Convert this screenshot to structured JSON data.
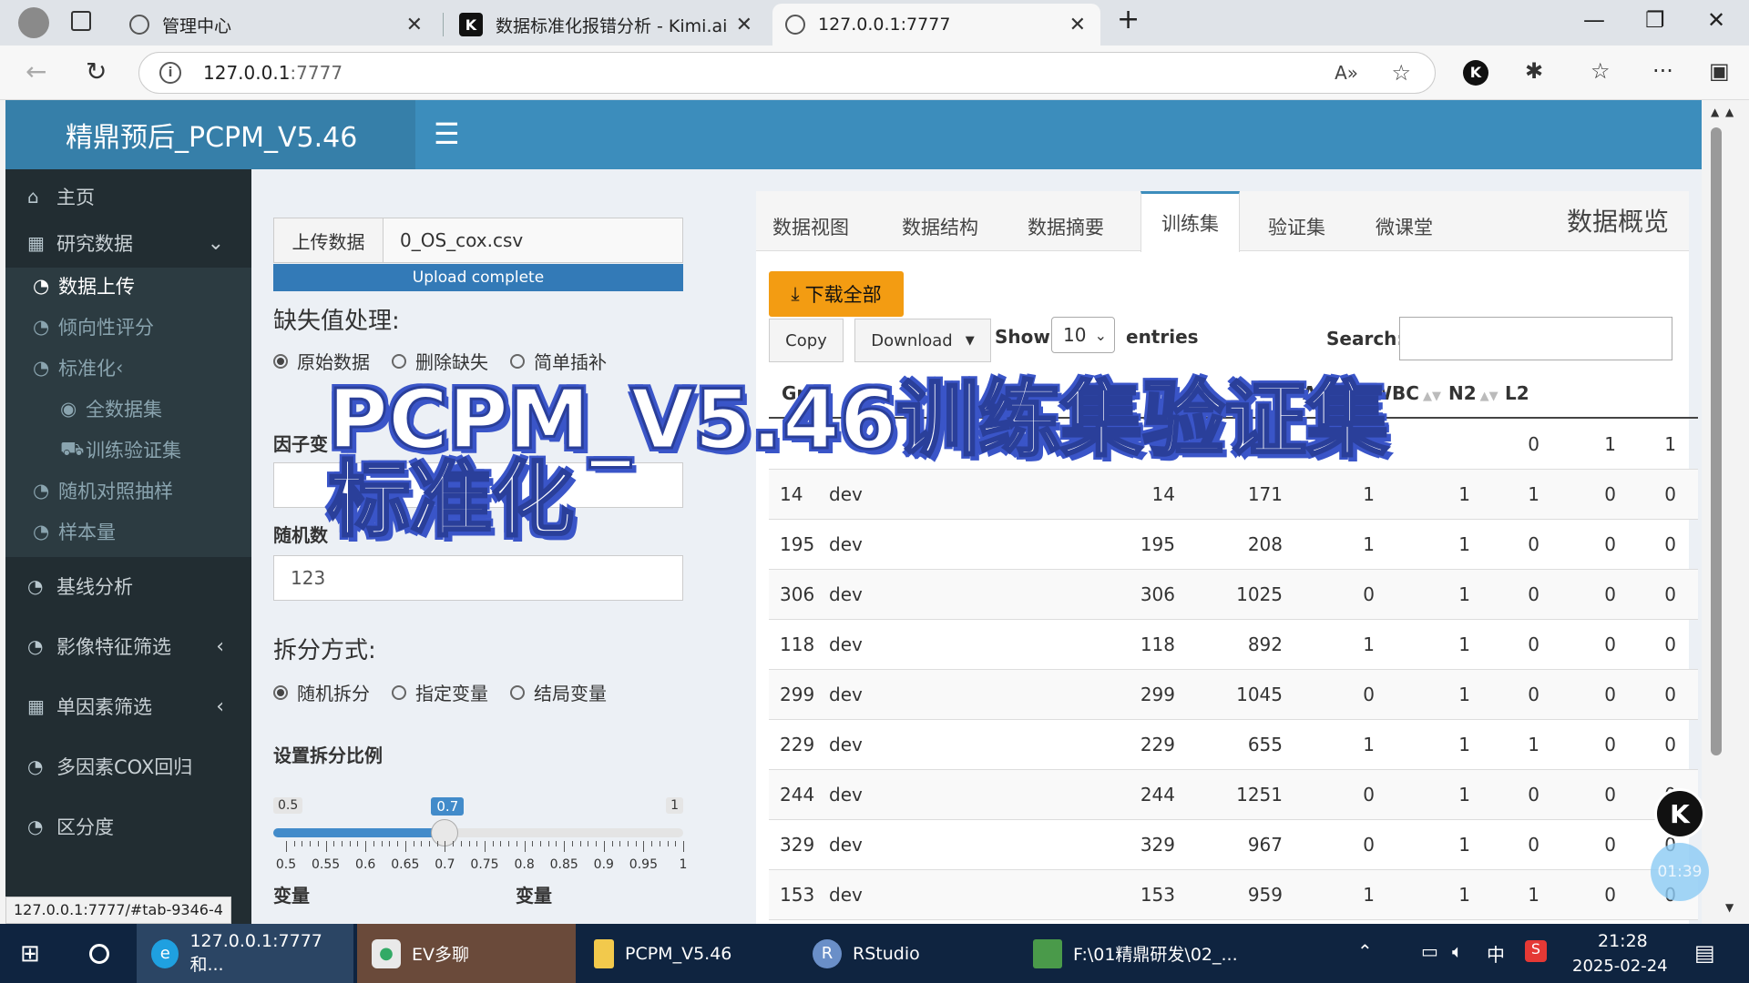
{
  "browser": {
    "tabs": [
      {
        "label": "管理中心",
        "icon": "globe-icon"
      },
      {
        "label": "数据标准化报错分析 - Kimi.ai",
        "icon": "kimi-icon"
      },
      {
        "label": "127.0.0.1:7777",
        "icon": "globe-icon"
      }
    ],
    "url_host": "127.0.0.1",
    "url_port": ":7777",
    "status_url": "127.0.0.1:7777/#tab-9346-4"
  },
  "app": {
    "title": "精鼎预后_PCPM_V5.46",
    "sidebar": [
      {
        "label": "主页"
      },
      {
        "label": "研究数据"
      },
      {
        "label": "数据上传"
      },
      {
        "label": "倾向性评分"
      },
      {
        "label": "标准化"
      },
      {
        "label": "全数据集"
      },
      {
        "label": "训练验证集"
      },
      {
        "label": "随机对照抽样"
      },
      {
        "label": "样本量"
      },
      {
        "label": "基线分析"
      },
      {
        "label": "影像特征筛选"
      },
      {
        "label": "单因素筛选"
      },
      {
        "label": "多因素COX回归"
      },
      {
        "label": "区分度"
      }
    ]
  },
  "form": {
    "upload_button": "上传数据",
    "file_name": "0_OS_cox.csv",
    "upload_status": "Upload complete",
    "missing_label": "缺失值处理:",
    "missing_options": [
      "原始数据",
      "删除缺失",
      "简单插补"
    ],
    "factor_label": "因子变",
    "seed_label": "随机数",
    "seed_value": "123",
    "split_label": "拆分方式:",
    "split_options": [
      "随机拆分",
      "指定变量",
      "结局变量"
    ],
    "ratio_label": "设置拆分比例",
    "ratio": {
      "min": "0.5",
      "max": "1",
      "value": "0.7",
      "ticks": [
        "0.5",
        "0.55",
        "0.6",
        "0.65",
        "0.7",
        "0.75",
        "0.8",
        "0.85",
        "0.9",
        "0.95",
        "1"
      ]
    },
    "var_label_1": "变量",
    "var_label_2": "变量"
  },
  "right": {
    "tabs": [
      "数据视图",
      "数据结构",
      "数据摘要",
      "训练集",
      "验证集",
      "微课堂"
    ],
    "title": "数据概览",
    "download_all": "下载全部",
    "copy": "Copy",
    "download": "Download",
    "show": "Show",
    "entries_value": "10",
    "entries": "entries",
    "search": "Search:",
    "columns": [
      "Grou",
      "",
      "",
      "",
      "",
      "Age",
      "WBC",
      "N2",
      "L2"
    ],
    "rows": [
      [
        "",
        "",
        "",
        "",
        "",
        "",
        "0",
        "1",
        "1"
      ],
      [
        "14",
        "dev",
        "14",
        "171",
        "1",
        "1",
        "1",
        "0",
        "0"
      ],
      [
        "195",
        "dev",
        "195",
        "208",
        "1",
        "1",
        "0",
        "0",
        "0"
      ],
      [
        "306",
        "dev",
        "306",
        "1025",
        "0",
        "1",
        "0",
        "0",
        "0"
      ],
      [
        "118",
        "dev",
        "118",
        "892",
        "1",
        "1",
        "0",
        "0",
        "0"
      ],
      [
        "299",
        "dev",
        "299",
        "1045",
        "0",
        "1",
        "0",
        "0",
        "0"
      ],
      [
        "229",
        "dev",
        "229",
        "655",
        "1",
        "1",
        "1",
        "0",
        "0"
      ],
      [
        "244",
        "dev",
        "244",
        "1251",
        "0",
        "1",
        "0",
        "0",
        "0"
      ],
      [
        "329",
        "dev",
        "329",
        "967",
        "0",
        "1",
        "0",
        "0",
        "0"
      ],
      [
        "153",
        "dev",
        "153",
        "959",
        "1",
        "1",
        "1",
        "0",
        "0"
      ]
    ]
  },
  "overlay": {
    "line1": "PCPM_V5.46训练集验证集",
    "line2": "标准化"
  },
  "floating": {
    "kimi": "K",
    "timer": "01:39"
  },
  "taskbar": {
    "items": [
      {
        "label": "127.0.0.1:7777 和..."
      },
      {
        "label": "EV多聊"
      },
      {
        "label": "PCPM_V5.46"
      },
      {
        "label": "RStudio"
      },
      {
        "label": "F:\\01精鼎研发\\02_..."
      }
    ],
    "ime": "中",
    "time": "21:28",
    "date": "2025-02-24"
  }
}
